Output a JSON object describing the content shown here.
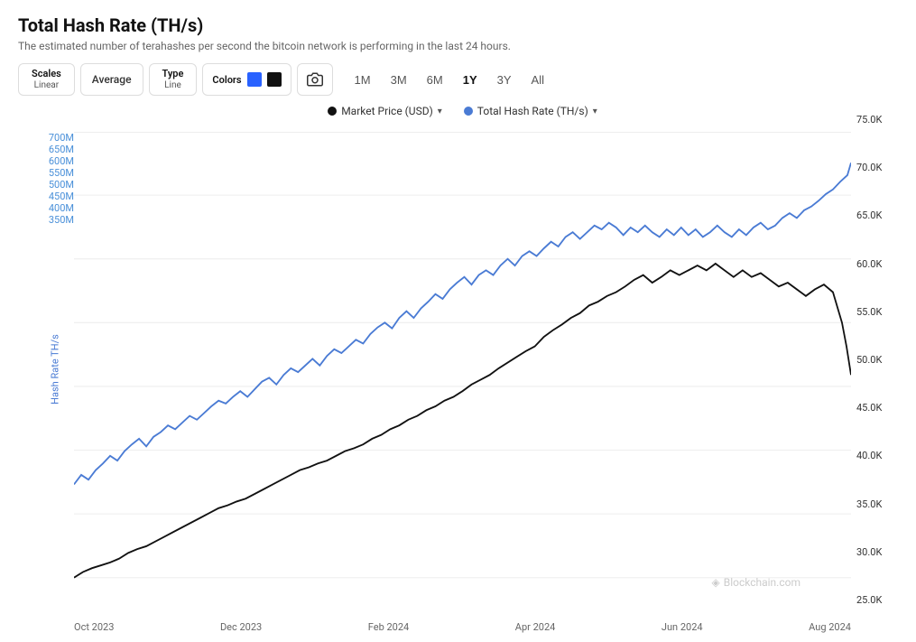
{
  "page": {
    "title": "Total Hash Rate (TH/s)",
    "subtitle": "The estimated number of terahashes per second the bitcoin network is performing in the last 24 hours."
  },
  "toolbar": {
    "scales_label": "Scales",
    "scales_value": "Linear",
    "average_label": "Average",
    "type_label": "Type",
    "type_value": "Line",
    "colors_label": "Colors",
    "color1": "#2962ff",
    "color2": "#111111",
    "camera_icon": "📷",
    "time_options": [
      "1M",
      "3M",
      "6M",
      "1Y",
      "3Y",
      "All"
    ],
    "active_time": "1Y"
  },
  "legend": {
    "item1_label": "Market Price (USD)",
    "item1_color": "#111111",
    "item2_label": "Total Hash Rate (TH/s)",
    "item2_color": "#4a7bd4"
  },
  "y_axis_left": {
    "labels": [
      "700M",
      "650M",
      "600M",
      "550M",
      "500M",
      "450M",
      "400M",
      "350M"
    ],
    "axis_label": "Hash Rate TH/s"
  },
  "y_axis_right": {
    "labels": [
      "75.0K",
      "70.0K",
      "65.0K",
      "60.0K",
      "55.0K",
      "50.0K",
      "45.0K",
      "40.0K",
      "35.0K",
      "30.0K",
      "25.0K"
    ]
  },
  "x_axis": {
    "labels": [
      "Oct 2023",
      "Dec 2023",
      "Feb 2024",
      "Apr 2024",
      "Jun 2024",
      "Aug 2024"
    ]
  },
  "watermark": {
    "text": "Blockchain.com",
    "icon": "◈"
  }
}
